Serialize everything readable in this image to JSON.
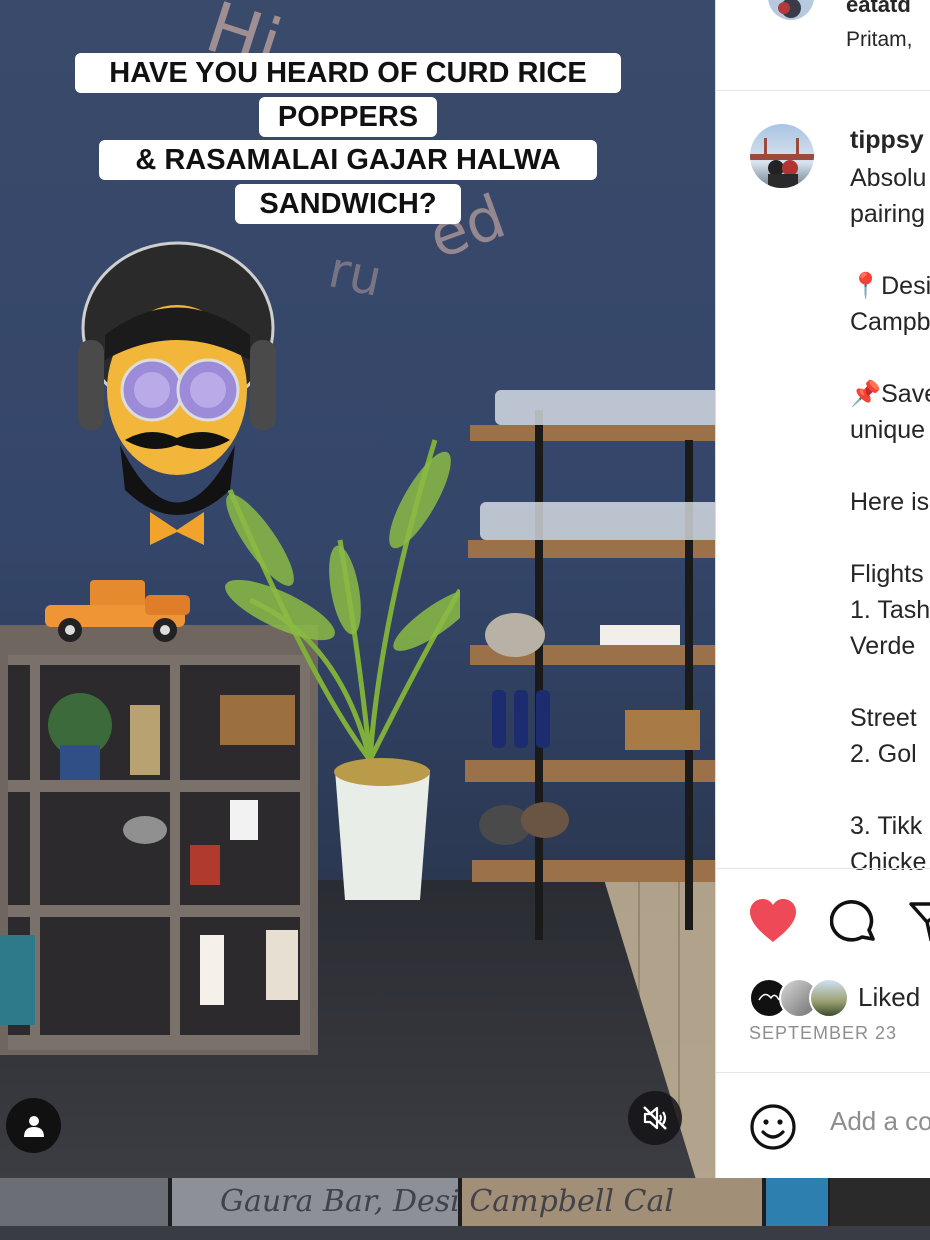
{
  "video": {
    "caption_lines": [
      "HAVE YOU HEARD OF CURD RICE",
      "POPPERS",
      "& RASAMALAI GAJAR HALWA",
      "SANDWICH?"
    ],
    "user_tag_icon": "person-icon",
    "mute_icon": "speaker-muted-icon"
  },
  "strip": {
    "caption": "Gaura Bar, Desi Campbell Cal"
  },
  "panel": {
    "top_comment": {
      "handle": "eatatd",
      "subtext": "Pritam,"
    },
    "post": {
      "handle": "tippsy",
      "caption_lines": [
        "Absolu",
        "pairing",
        "",
        "📍Desi",
        "Campb",
        "",
        "📌Save",
        "unique",
        "",
        "Here is",
        "",
        "Flights",
        "1. Tash",
        "Verde",
        "",
        "Street",
        "2. Gol",
        "",
        "3. Tikk",
        "Chicke"
      ]
    },
    "actions": {
      "like_icon": "heart-filled-icon",
      "comment_icon": "speech-bubble-icon",
      "share_icon": "paper-plane-icon",
      "liked": true,
      "like_color": "#ed4956"
    },
    "liked_by": "Liked",
    "date": "SEPTEMBER 23",
    "comment_box": {
      "emoji_icon": "smiley-icon",
      "placeholder": "Add a co"
    }
  }
}
